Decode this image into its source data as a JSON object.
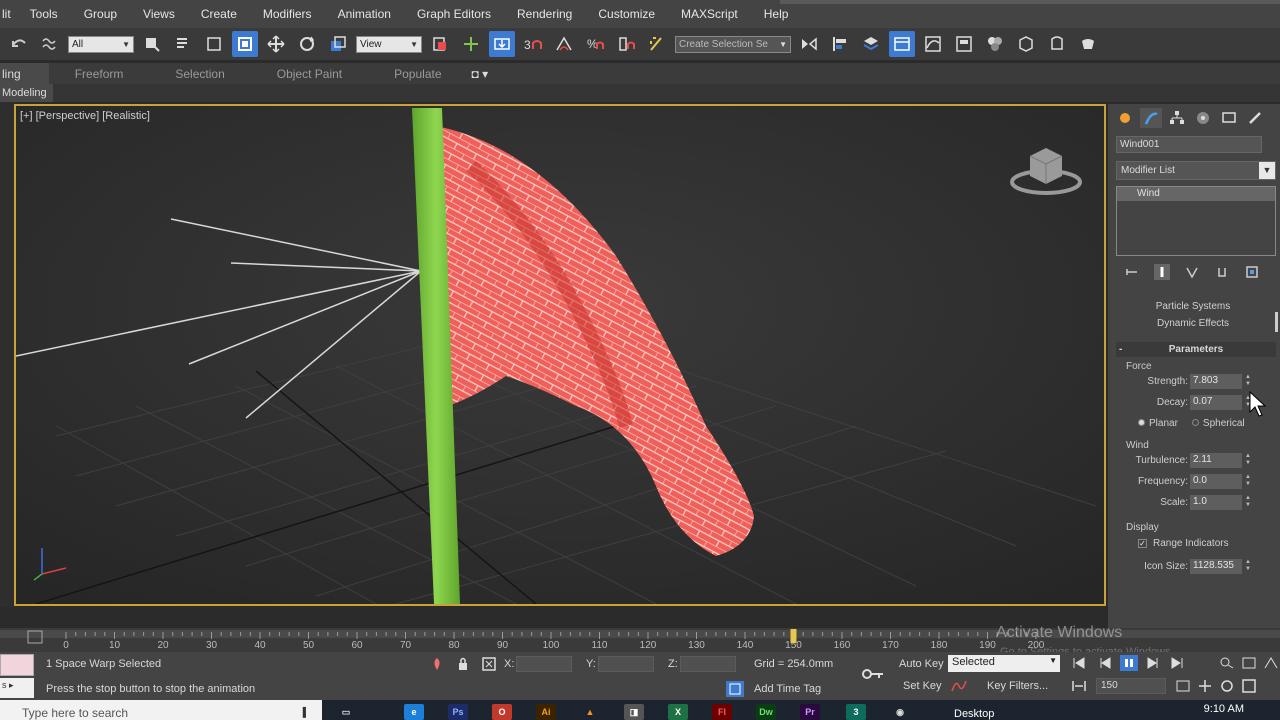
{
  "menu": [
    "lit",
    "Tools",
    "Group",
    "Views",
    "Create",
    "Modifiers",
    "Animation",
    "Graph Editors",
    "Rendering",
    "Customize",
    "MAXScript",
    "Help"
  ],
  "toolbar": {
    "selection_filter": "All",
    "ref_coord": "View",
    "named_selection_placeholder": "Create Selection Se"
  },
  "ribbon": {
    "tabs": [
      "ling",
      "Freeform",
      "Selection",
      "Object Paint",
      "Populate"
    ],
    "sub_label": "Modeling"
  },
  "viewport": {
    "label": "[+] [Perspective] [Realistic]",
    "flag_color": "#f0605a",
    "pole_color": "#79c242"
  },
  "command_panel": {
    "object_name": "Wind001",
    "modifier_list": "Modifier List",
    "stack_item": "Wind",
    "category_1": "Particle Systems",
    "category_2": "Dynamic Effects",
    "parameters_title": "Parameters",
    "force_group": "Force",
    "strength_label": "Strength:",
    "strength_value": "7.803",
    "decay_label": "Decay:",
    "decay_value": "0.07",
    "planar_label": "Planar",
    "spherical_label": "Spherical",
    "wind_group": "Wind",
    "turbulence_label": "Turbulence:",
    "turbulence_value": "2.11",
    "frequency_label": "Frequency:",
    "frequency_value": "0.0",
    "scale_label": "Scale:",
    "scale_value": "1.0",
    "display_group": "Display",
    "range_indicators_label": "Range Indicators",
    "icon_size_label": "Icon Size:",
    "icon_size_value": "1128.535"
  },
  "timeline": {
    "ticks": [
      "0",
      "10",
      "20",
      "30",
      "40",
      "50",
      "60",
      "70",
      "80",
      "90",
      "100",
      "110",
      "120",
      "130",
      "140",
      "150",
      "160",
      "170",
      "180",
      "190",
      "200"
    ],
    "current_frame": 150
  },
  "watermark": {
    "title": "Activate Windows",
    "subtitle": "Go to Settings to activate Windows."
  },
  "status": {
    "selection": "1 Space Warp Selected",
    "prompt": "Press the stop button to stop the animation",
    "x_label": "X:",
    "y_label": "Y:",
    "z_label": "Z:",
    "grid": "Grid = 254.0mm",
    "add_time_tag": "Add Time Tag",
    "auto_key": "Auto Key",
    "set_key": "Set Key",
    "key_mode": "Selected",
    "key_filters": "Key Filters...",
    "frame": "150",
    "left_box": "s ▸"
  },
  "taskbar": {
    "search_placeholder": "Type here to search",
    "desktop": "Desktop",
    "clock": "9:10 AM"
  }
}
